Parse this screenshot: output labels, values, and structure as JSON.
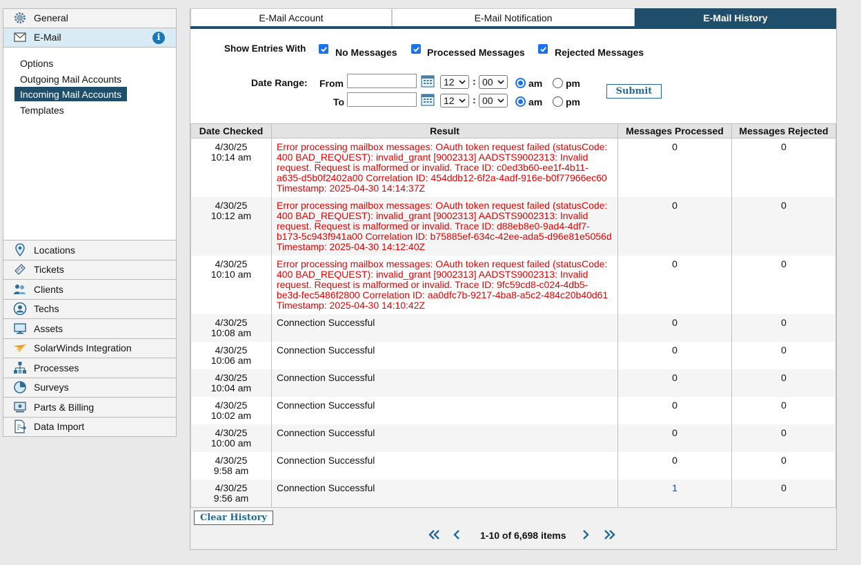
{
  "sidebar": {
    "top_items": [
      {
        "label": "General"
      },
      {
        "label": "E-Mail",
        "badge": "i"
      }
    ],
    "email_links": [
      {
        "label": "Options"
      },
      {
        "label": "Outgoing Mail Accounts"
      },
      {
        "label": "Incoming Mail Accounts"
      },
      {
        "label": "Templates"
      }
    ],
    "bottom_items": [
      {
        "label": "Locations",
        "icon": "location-pin-icon"
      },
      {
        "label": "Tickets",
        "icon": "ticket-icon"
      },
      {
        "label": "Clients",
        "icon": "clients-icon"
      },
      {
        "label": "Techs",
        "icon": "tech-icon"
      },
      {
        "label": "Assets",
        "icon": "monitor-icon"
      },
      {
        "label": "SolarWinds Integration",
        "icon": "solarwinds-icon"
      },
      {
        "label": "Processes",
        "icon": "processes-icon"
      },
      {
        "label": "Surveys",
        "icon": "pie-chart-icon"
      },
      {
        "label": "Parts & Billing",
        "icon": "billing-icon"
      },
      {
        "label": "Data Import",
        "icon": "import-icon"
      }
    ]
  },
  "tabs": [
    {
      "label": "E-Mail Account"
    },
    {
      "label": "E-Mail Notification"
    },
    {
      "label": "E-Mail History"
    }
  ],
  "filters": {
    "show_entries_label": "Show Entries With",
    "options": [
      "No Messages",
      "Processed Messages",
      "Rejected Messages"
    ],
    "date_range_label": "Date Range:",
    "from_label": "From",
    "to_label": "To",
    "from": {
      "date": "",
      "hour": "12",
      "minute": "00",
      "ampm": "am"
    },
    "to": {
      "date": "",
      "hour": "12",
      "minute": "00",
      "ampm": "am"
    },
    "colon": ":",
    "am_label": "am",
    "pm_label": "pm",
    "submit_label": "Submit"
  },
  "table": {
    "headers": [
      "Date Checked",
      "Result",
      "Messages Processed",
      "Messages Rejected"
    ],
    "rows": [
      {
        "date": "4/30/25",
        "time": "10:14 am",
        "result": "Error processing mailbox messages: OAuth token request failed (statusCode: 400 BAD_REQUEST): invalid_grant [9002313] AADSTS9002313: Invalid request. Request is malformed or invalid. Trace ID: c0ed3b60-ee1f-4b11-a635-d5b0f2402a00 Correlation ID: 454ddb12-6f2a-4adf-916e-b0f77966ec60 Timestamp: 2025-04-30 14:14:37Z",
        "error": true,
        "processed": "0",
        "rejected": "0"
      },
      {
        "date": "4/30/25",
        "time": "10:12 am",
        "result": "Error processing mailbox messages: OAuth token request failed (statusCode: 400 BAD_REQUEST): invalid_grant [9002313] AADSTS9002313: Invalid request. Request is malformed or invalid. Trace ID: d88eb8e0-9ad4-4df7-b173-5c943f941a00 Correlation ID: b75885ef-634c-42ee-ada5-d96e81e5056d Timestamp: 2025-04-30 14:12:40Z",
        "error": true,
        "processed": "0",
        "rejected": "0"
      },
      {
        "date": "4/30/25",
        "time": "10:10 am",
        "result": "Error processing mailbox messages: OAuth token request failed (statusCode: 400 BAD_REQUEST): invalid_grant [9002313] AADSTS9002313: Invalid request. Request is malformed or invalid. Trace ID: 9fc59cd8-c024-4db5-be3d-fec5486f2800 Correlation ID: aa0dfc7b-9217-4ba8-a5c2-484c20b40d61 Timestamp: 2025-04-30 14:10:42Z",
        "error": true,
        "processed": "0",
        "rejected": "0"
      },
      {
        "date": "4/30/25",
        "time": "10:08 am",
        "result": "Connection Successful",
        "error": false,
        "processed": "0",
        "rejected": "0"
      },
      {
        "date": "4/30/25",
        "time": "10:06 am",
        "result": "Connection Successful",
        "error": false,
        "processed": "0",
        "rejected": "0"
      },
      {
        "date": "4/30/25",
        "time": "10:04 am",
        "result": "Connection Successful",
        "error": false,
        "processed": "0",
        "rejected": "0"
      },
      {
        "date": "4/30/25",
        "time": "10:02 am",
        "result": "Connection Successful",
        "error": false,
        "processed": "0",
        "rejected": "0"
      },
      {
        "date": "4/30/25",
        "time": "10:00 am",
        "result": "Connection Successful",
        "error": false,
        "processed": "0",
        "rejected": "0"
      },
      {
        "date": "4/30/25",
        "time": "9:58 am",
        "result": "Connection Successful",
        "error": false,
        "processed": "0",
        "rejected": "0"
      },
      {
        "date": "4/30/25",
        "time": "9:56 am",
        "result": "Connection Successful",
        "error": false,
        "processed": "1",
        "processed_link": true,
        "rejected": "0"
      }
    ]
  },
  "footer": {
    "clear_label": "Clear History",
    "pager_text": "1-10 of 6,698 items"
  },
  "colors": {
    "accent": "#1f4e6b",
    "error": "#e60000",
    "link": "#1a3fc0",
    "checkbox": "#1a73e8"
  }
}
